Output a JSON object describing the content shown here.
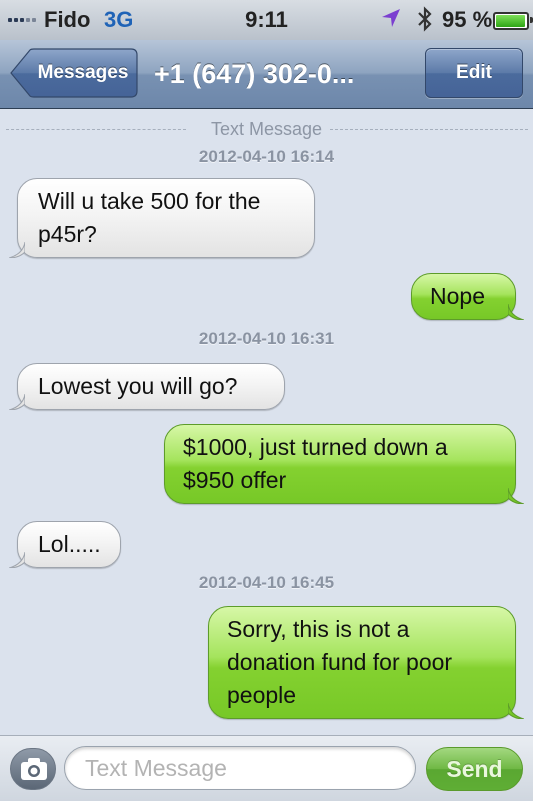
{
  "status_bar": {
    "carrier": "Fido",
    "network": "3G",
    "time": "9:11",
    "battery_percent": "95 %",
    "battery_level": 0.95,
    "icons": [
      "signal-bars-icon",
      "location-arrow-icon",
      "bluetooth-icon",
      "battery-icon"
    ]
  },
  "nav": {
    "back_label": "Messages",
    "title": "+1 (647) 302-0...",
    "edit_label": "Edit"
  },
  "conversation": {
    "divider_label": "Text Message",
    "timestamps": [
      "2012-04-10 16:14",
      "2012-04-10 16:31",
      "2012-04-10 16:45"
    ],
    "messages": [
      {
        "direction": "incoming",
        "lines": [
          "Will u take 500 for the",
          "p45r?"
        ]
      },
      {
        "direction": "outgoing",
        "lines": [
          "Nope"
        ]
      },
      {
        "direction": "incoming",
        "lines": [
          "Lowest you will go?"
        ]
      },
      {
        "direction": "outgoing",
        "lines": [
          "$1000, just turned down a",
          "$950 offer"
        ]
      },
      {
        "direction": "incoming",
        "lines": [
          "Lol....."
        ]
      },
      {
        "direction": "outgoing",
        "lines": [
          "Sorry, this is not a",
          "donation fund for poor",
          "people"
        ]
      }
    ]
  },
  "composer": {
    "placeholder": "Text Message",
    "value": "",
    "send_label": "Send"
  },
  "colors": {
    "background": "#dbe2ed",
    "nav_bar": "#7891b2",
    "outgoing_bubble": "#84d130",
    "incoming_bubble": "#f4f4f4",
    "send_button": "#6fb844",
    "network_text": "#1f63b7"
  }
}
